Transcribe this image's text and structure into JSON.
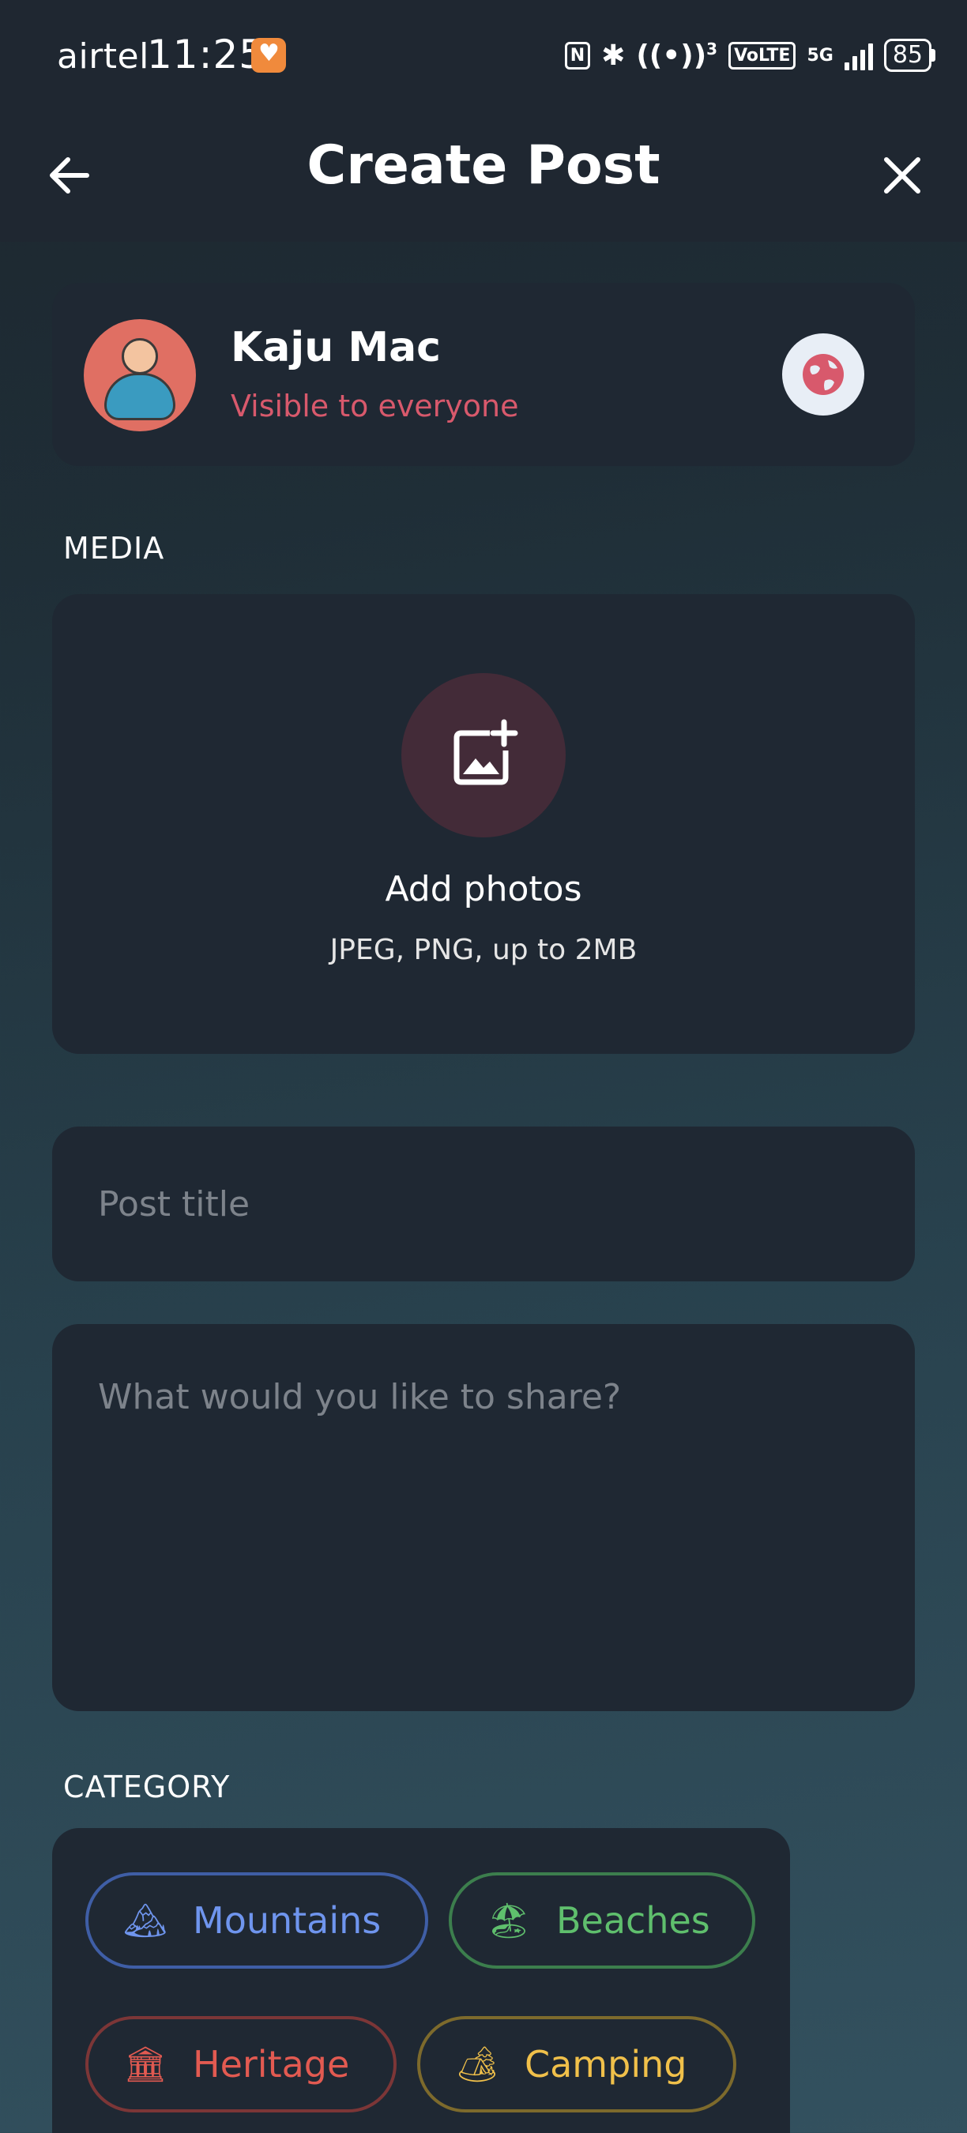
{
  "status_bar": {
    "carrier": "airtel",
    "time": "11:25",
    "icons": [
      "nfc-icon",
      "bluetooth-icon",
      "hotspot-icon",
      "volte-icon",
      "5g-icon",
      "signal-icon"
    ],
    "volte": "VoLTE",
    "network": "5G",
    "hotspot_count": "3",
    "battery": "85"
  },
  "header": {
    "title": "Create Post",
    "back_icon": "arrow-left-icon",
    "close_icon": "close-icon"
  },
  "user": {
    "name": "Kaju Mac",
    "visibility": "Visible to everyone",
    "visibility_color": "#d8596c",
    "globe_icon": "globe-icon"
  },
  "media": {
    "section_label": "MEDIA",
    "add_label": "Add photos",
    "hint": "JPEG, PNG, up to 2MB",
    "icon": "add-photo-icon"
  },
  "form": {
    "title_placeholder": "Post title",
    "body_placeholder": "What would you like to share?"
  },
  "category": {
    "section_label": "CATEGORY",
    "chips": [
      {
        "label": "Mountains",
        "emoji": "🏔",
        "color": "#6f95ee"
      },
      {
        "label": "Beaches",
        "emoji": "🏖",
        "color": "#5fbf6d"
      },
      {
        "label": "Heritage",
        "emoji": "🏛",
        "color": "#e25a51"
      },
      {
        "label": "Camping",
        "emoji": "🏕",
        "color": "#f0c04a"
      }
    ]
  }
}
